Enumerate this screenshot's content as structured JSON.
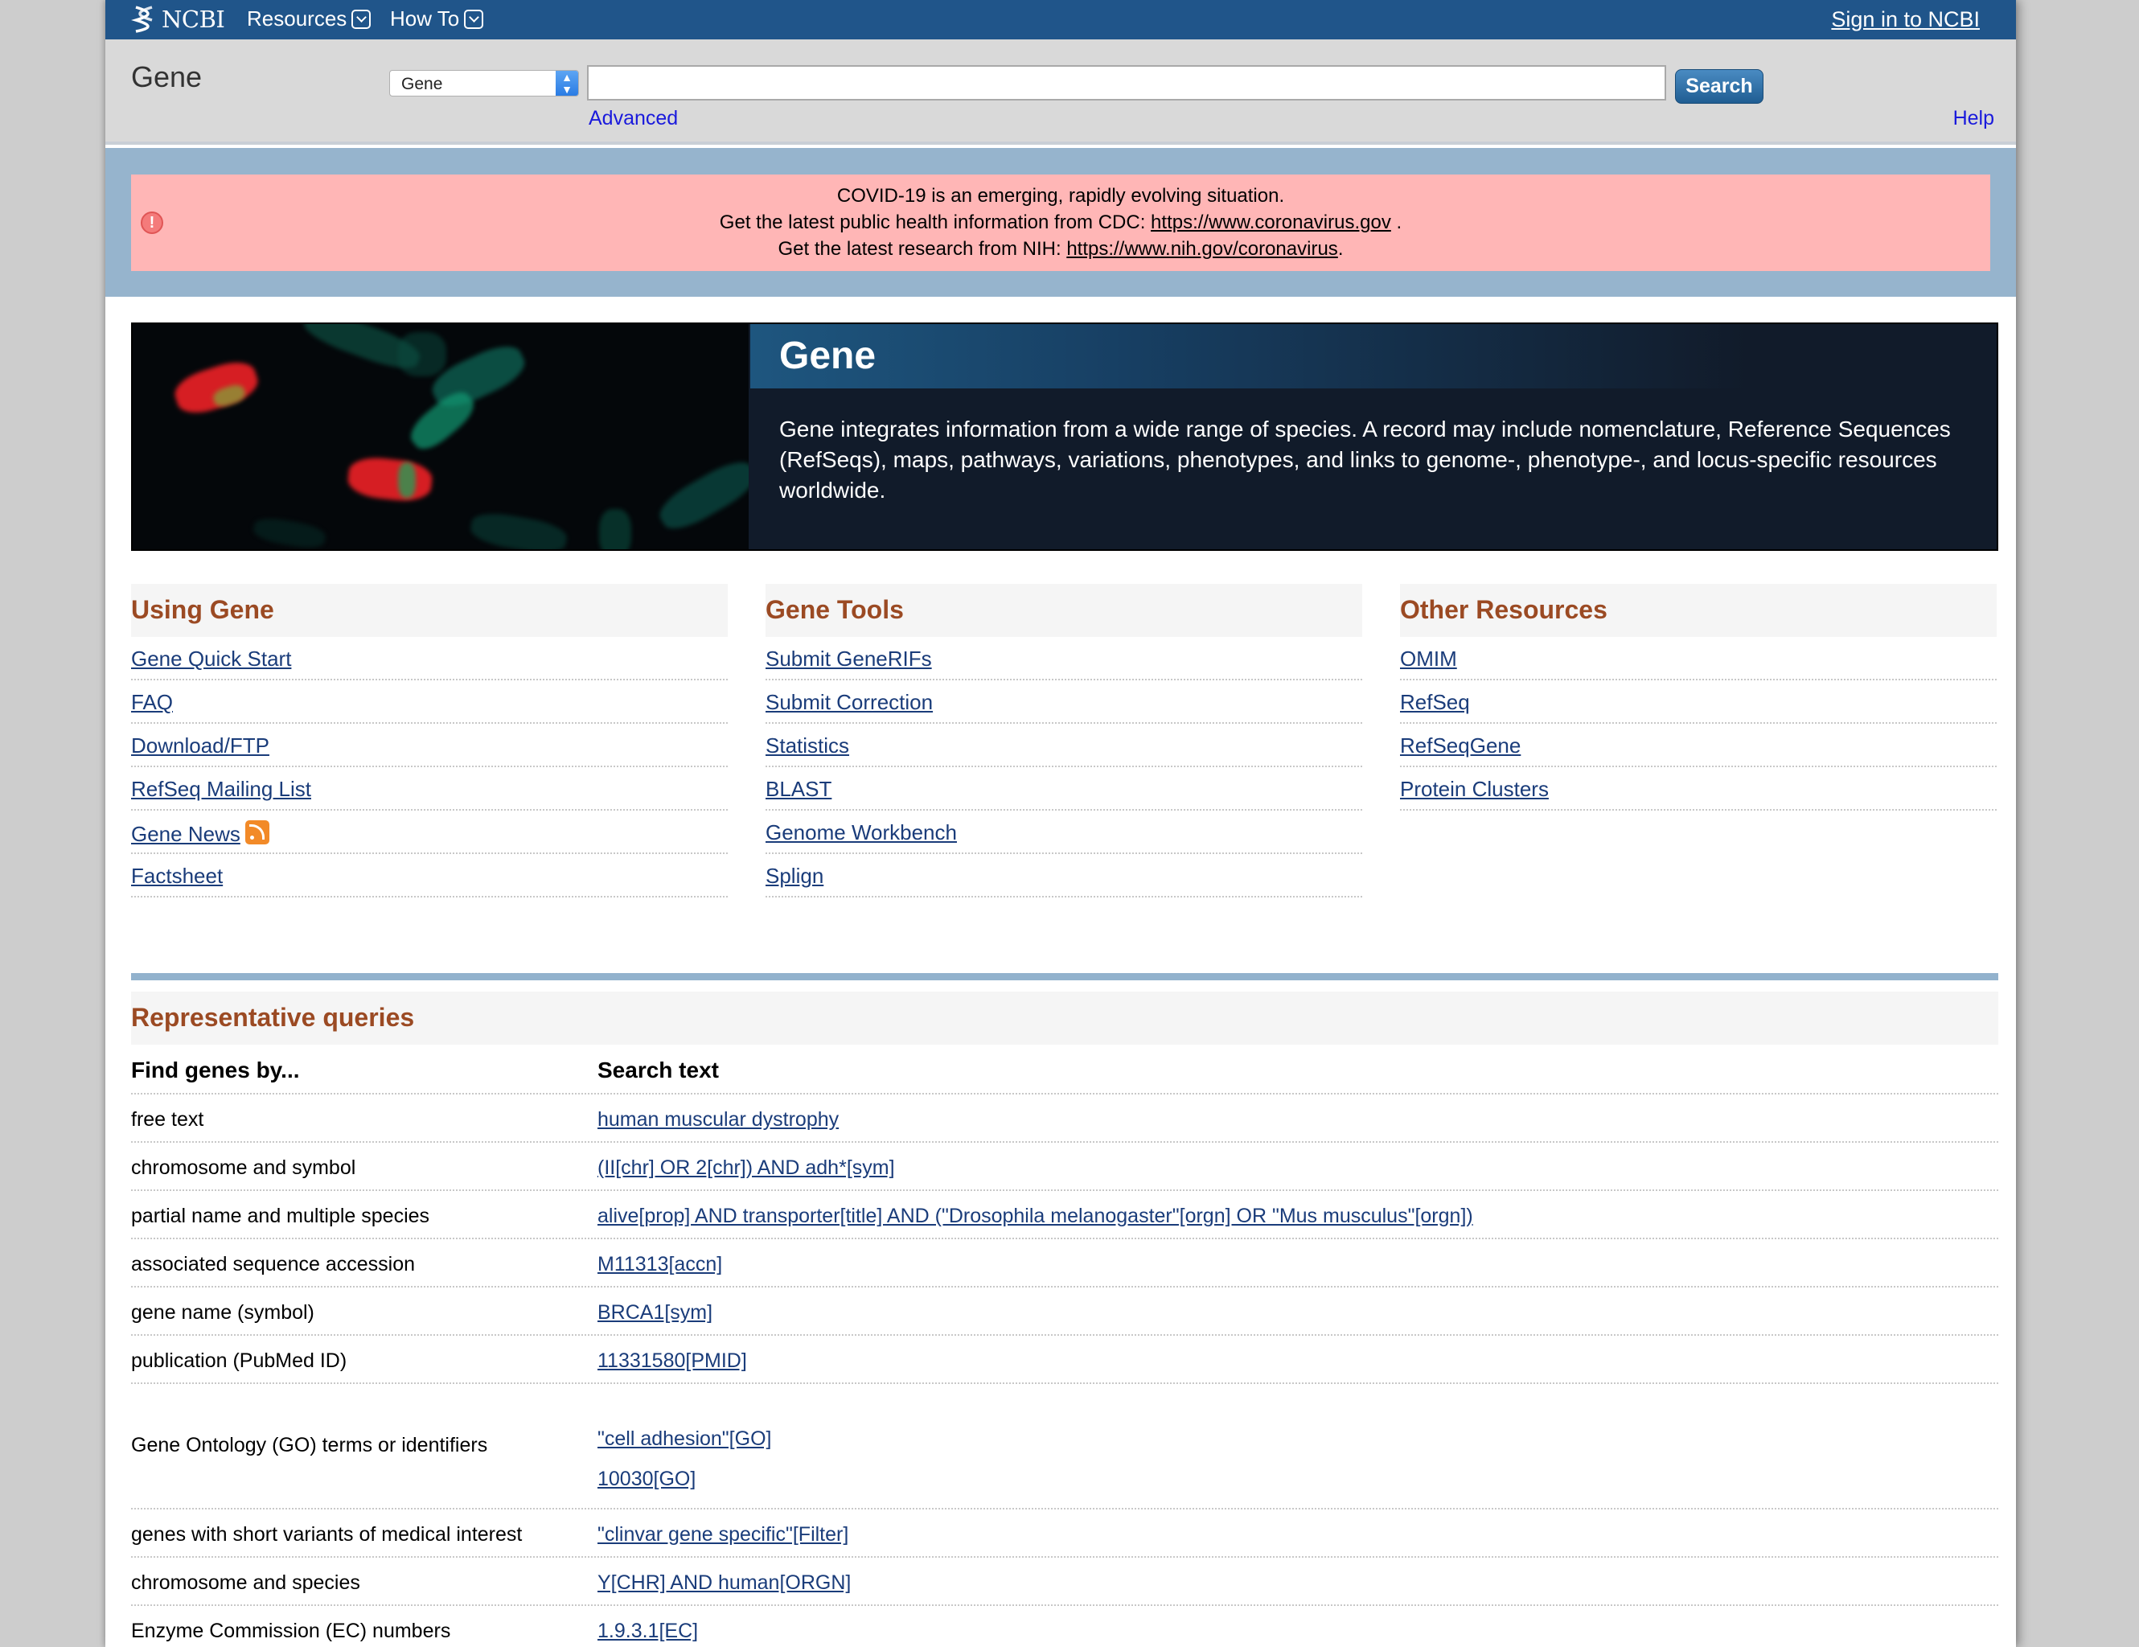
{
  "topbar": {
    "logo_text": "NCBI",
    "resources_label": "Resources",
    "howto_label": "How To",
    "signin_label": "Sign in to NCBI"
  },
  "search": {
    "db_title": "Gene",
    "db_selected": "Gene",
    "term_value": "",
    "button_label": "Search",
    "advanced_label": "Advanced",
    "help_label": "Help"
  },
  "alert": {
    "line1": "COVID-19 is an emerging, rapidly evolving situation.",
    "line2_prefix": "Get the latest public health information from CDC:",
    "line2_link": "https://www.coronavirus.gov",
    "line2_suffix": ".",
    "line3_prefix": "Get the latest research from NIH:",
    "line3_link": "https://www.nih.gov/coronavirus",
    "line3_suffix": "."
  },
  "hero": {
    "title": "Gene",
    "description": "Gene integrates information from a wide range of species. A record may include nomenclature, Reference Sequences (RefSeqs), maps, pathways, variations, phenotypes, and links to genome-, phenotype-, and locus-specific resources worldwide."
  },
  "columns": {
    "using_gene": {
      "title": "Using Gene",
      "items": [
        "Gene Quick Start",
        "FAQ",
        "Download/FTP",
        "RefSeq Mailing List",
        "Gene News",
        "Factsheet"
      ]
    },
    "gene_tools": {
      "title": "Gene Tools",
      "items": [
        "Submit GeneRIFs",
        "Submit Correction",
        "Statistics",
        "BLAST",
        "Genome Workbench",
        "Splign"
      ]
    },
    "other_resources": {
      "title": "Other Resources",
      "items": [
        "OMIM",
        "RefSeq",
        "RefSeqGene",
        "Protein Clusters"
      ]
    }
  },
  "queries": {
    "title": "Representative queries",
    "col1_header": "Find genes by...",
    "col2_header": "Search text",
    "rows": [
      {
        "label": "free text",
        "query": "human muscular dystrophy"
      },
      {
        "label": "chromosome and symbol",
        "query": "(II[chr] OR 2[chr]) AND adh*[sym]"
      },
      {
        "label": "partial name and multiple species",
        "query": "alive[prop] AND transporter[title] AND (\"Drosophila melanogaster\"[orgn] OR \"Mus musculus\"[orgn])"
      },
      {
        "label": "associated sequence accession",
        "query": "M11313[accn]"
      },
      {
        "label": "gene name (symbol)",
        "query": "BRCA1[sym]"
      },
      {
        "label": "publication (PubMed ID)",
        "query": "11331580[PMID]"
      }
    ],
    "go_row": {
      "label": "Gene Ontology (GO) terms or identifiers",
      "query1": "\"cell adhesion\"[GO]",
      "query2": "10030[GO]"
    },
    "rows2": [
      {
        "label": "genes with short variants of medical interest",
        "query": "\"clinvar gene specific\"[Filter]"
      },
      {
        "label": "chromosome and species",
        "query": "Y[CHR] AND human[ORGN]"
      },
      {
        "label": "Enzyme Commission (EC) numbers",
        "query": "1.9.3.1[EC]"
      }
    ]
  },
  "icons": {
    "logo": "ncbi-helix-icon",
    "alert": "warning-icon",
    "rss": "rss-feed-icon"
  },
  "colors": {
    "topbar": "#20558a",
    "section_heading": "#9b4a23",
    "link": "#1a3c7a",
    "alert_bg": "#ffb6b6"
  }
}
